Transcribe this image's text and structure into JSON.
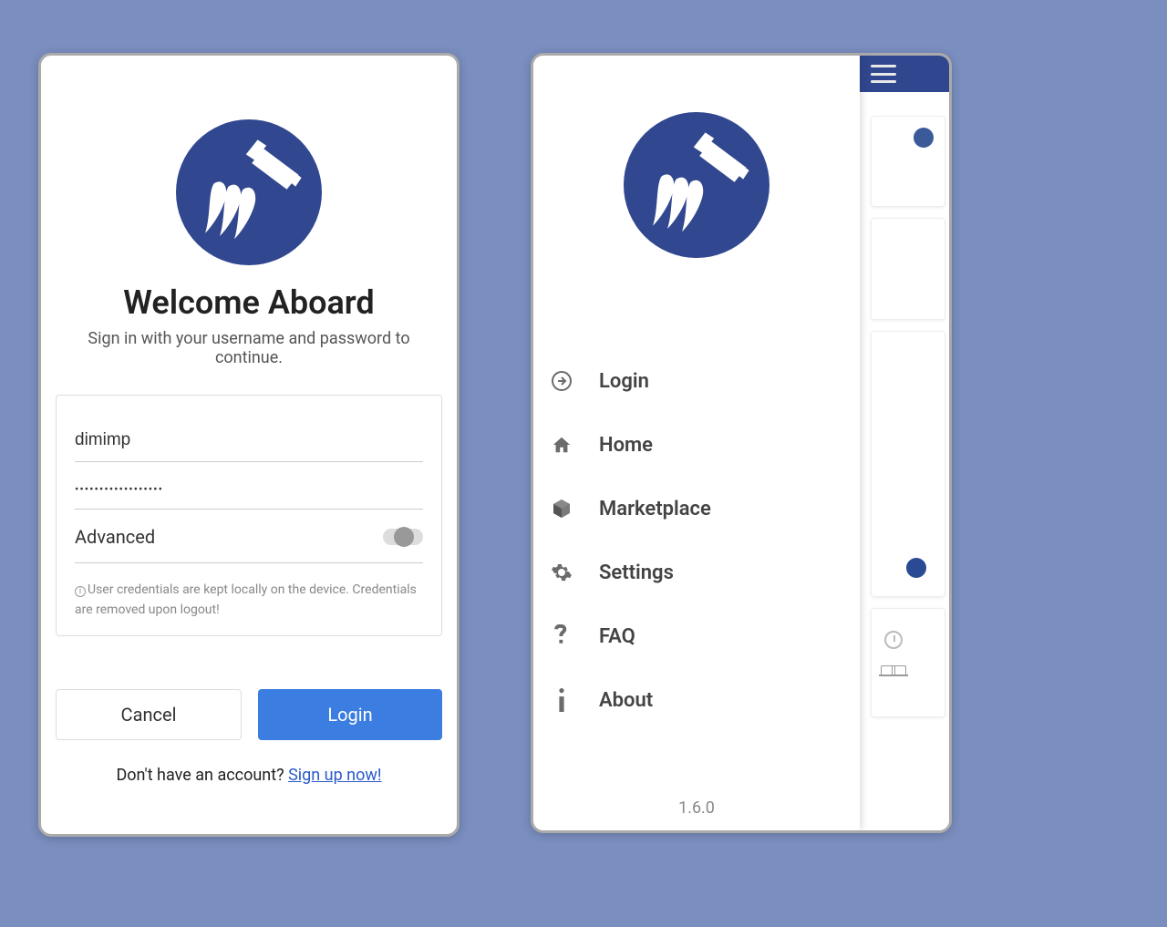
{
  "login": {
    "title": "Welcome Aboard",
    "subtitle": "Sign in with your username and password to continue.",
    "username_value": "dimimp",
    "password_masked": "••••••••••••••••••",
    "advanced_label": "Advanced",
    "advanced_on": false,
    "info_text": "User credentials are kept locally on the device. Credentials are removed upon logout!",
    "cancel_label": "Cancel",
    "login_label": "Login",
    "signup_prompt": "Don't have an account? ",
    "signup_link": "Sign up now!"
  },
  "drawer": {
    "items": [
      {
        "icon": "login-arrow-icon",
        "label": "Login"
      },
      {
        "icon": "home-icon",
        "label": "Home"
      },
      {
        "icon": "cube-icon",
        "label": "Marketplace"
      },
      {
        "icon": "gear-icon",
        "label": "Settings"
      },
      {
        "icon": "question-icon",
        "label": "FAQ"
      },
      {
        "icon": "info-icon",
        "label": "About"
      }
    ],
    "version": "1.6.0"
  },
  "colors": {
    "brand": "#31478f",
    "accent": "#3b7de0",
    "link": "#2a5ac8"
  }
}
